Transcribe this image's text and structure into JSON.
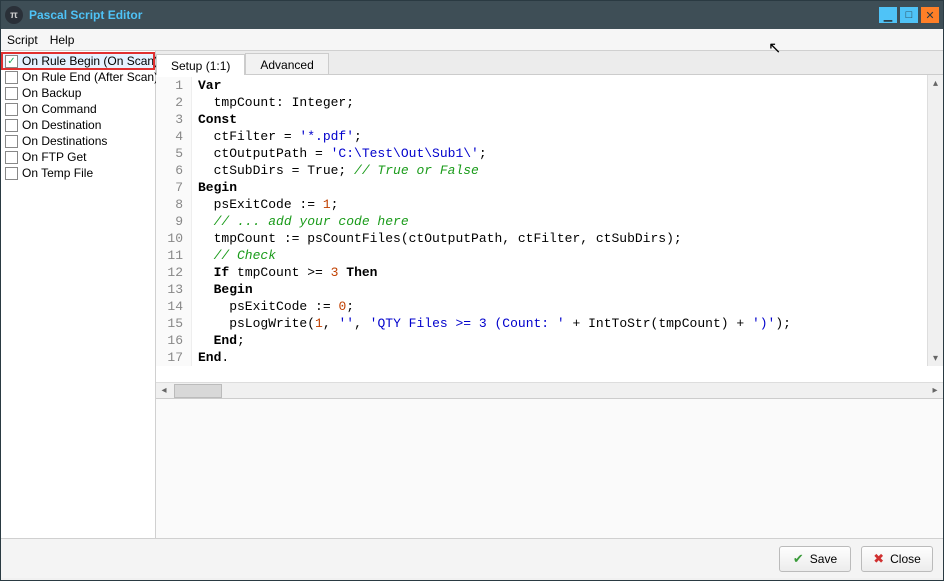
{
  "window": {
    "title": "Pascal Script Editor"
  },
  "menu": {
    "script": "Script",
    "help": "Help"
  },
  "sidebar": {
    "items": [
      {
        "label": "On Rule Begin (On Scan)",
        "checked": true,
        "selected": true
      },
      {
        "label": "On Rule End (After Scan)",
        "checked": false,
        "selected": false
      },
      {
        "label": "On Backup",
        "checked": false,
        "selected": false
      },
      {
        "label": "On Command",
        "checked": false,
        "selected": false
      },
      {
        "label": "On Destination",
        "checked": false,
        "selected": false
      },
      {
        "label": "On Destinations",
        "checked": false,
        "selected": false
      },
      {
        "label": "On FTP Get",
        "checked": false,
        "selected": false
      },
      {
        "label": "On Temp File",
        "checked": false,
        "selected": false
      }
    ]
  },
  "tabs": {
    "setup": "Setup (1:1)",
    "advanced": "Advanced"
  },
  "code": {
    "l1_kw": "Var",
    "l2_txt": "  tmpCount: Integer;",
    "l3_kw": "Const",
    "l4_a": "  ctFilter = ",
    "l4_s": "'*.pdf'",
    "l4_b": ";",
    "l5_a": "  ctOutputPath = ",
    "l5_s": "'C:\\Test\\Out\\Sub1\\'",
    "l5_b": ";",
    "l6_a": "  ctSubDirs = True; ",
    "l6_c": "// True or False",
    "l7_kw": "Begin",
    "l8_a": "  psExitCode := ",
    "l8_n": "1",
    "l8_b": ";",
    "l9_c": "  // ... add your code here",
    "l10_txt": "  tmpCount := psCountFiles(ctOutputPath, ctFilter, ctSubDirs);",
    "l11_c": "  // Check",
    "l12_a": "  ",
    "l12_kw1": "If",
    "l12_b": " tmpCount >= ",
    "l12_n": "3",
    "l12_c": " ",
    "l12_kw2": "Then",
    "l13_a": "  ",
    "l13_kw": "Begin",
    "l14_a": "    psExitCode := ",
    "l14_n": "0",
    "l14_b": ";",
    "l15_a": "    psLogWrite(",
    "l15_n": "1",
    "l15_b": ", ",
    "l15_s1": "''",
    "l15_c": ", ",
    "l15_s2": "'QTY Files >= 3 (Count: '",
    "l15_d": " + IntToStr(tmpCount) + ",
    "l15_s3": "')'",
    "l15_e": ");",
    "l16_a": "  ",
    "l16_kw": "End",
    "l16_b": ";",
    "l17_kw": "End",
    "l17_b": "."
  },
  "linenums": {
    "n1": "1",
    "n2": "2",
    "n3": "3",
    "n4": "4",
    "n5": "5",
    "n6": "6",
    "n7": "7",
    "n8": "8",
    "n9": "9",
    "n10": "10",
    "n11": "11",
    "n12": "12",
    "n13": "13",
    "n14": "14",
    "n15": "15",
    "n16": "16",
    "n17": "17"
  },
  "buttons": {
    "save": "Save",
    "close": "Close"
  }
}
